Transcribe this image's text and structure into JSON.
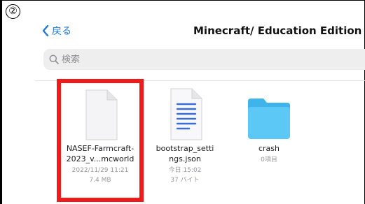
{
  "step_marker": "②",
  "nav": {
    "back_label": "戻る",
    "title": "Minecraft/ Education Edition"
  },
  "search": {
    "placeholder": "検索"
  },
  "files": [
    {
      "name_line1": "NASEF-Farmcraft-",
      "name_line2": "2023_v...mcworld",
      "date": "2022/11/29 11:21",
      "size": "7.4 MB",
      "icon": "blank-document-icon"
    },
    {
      "name_line1": "bootstrap_setti",
      "name_line2": "ngs.json",
      "date": "今日 15:02",
      "size": "37 バイト",
      "icon": "text-document-icon"
    },
    {
      "name_line1": "crash",
      "name_line2": "",
      "date": "0項目",
      "size": "",
      "icon": "folder-icon"
    }
  ],
  "colors": {
    "accent": "#1f7ae0",
    "highlight": "#ef1b1b",
    "folder": "#5bc8f5"
  }
}
